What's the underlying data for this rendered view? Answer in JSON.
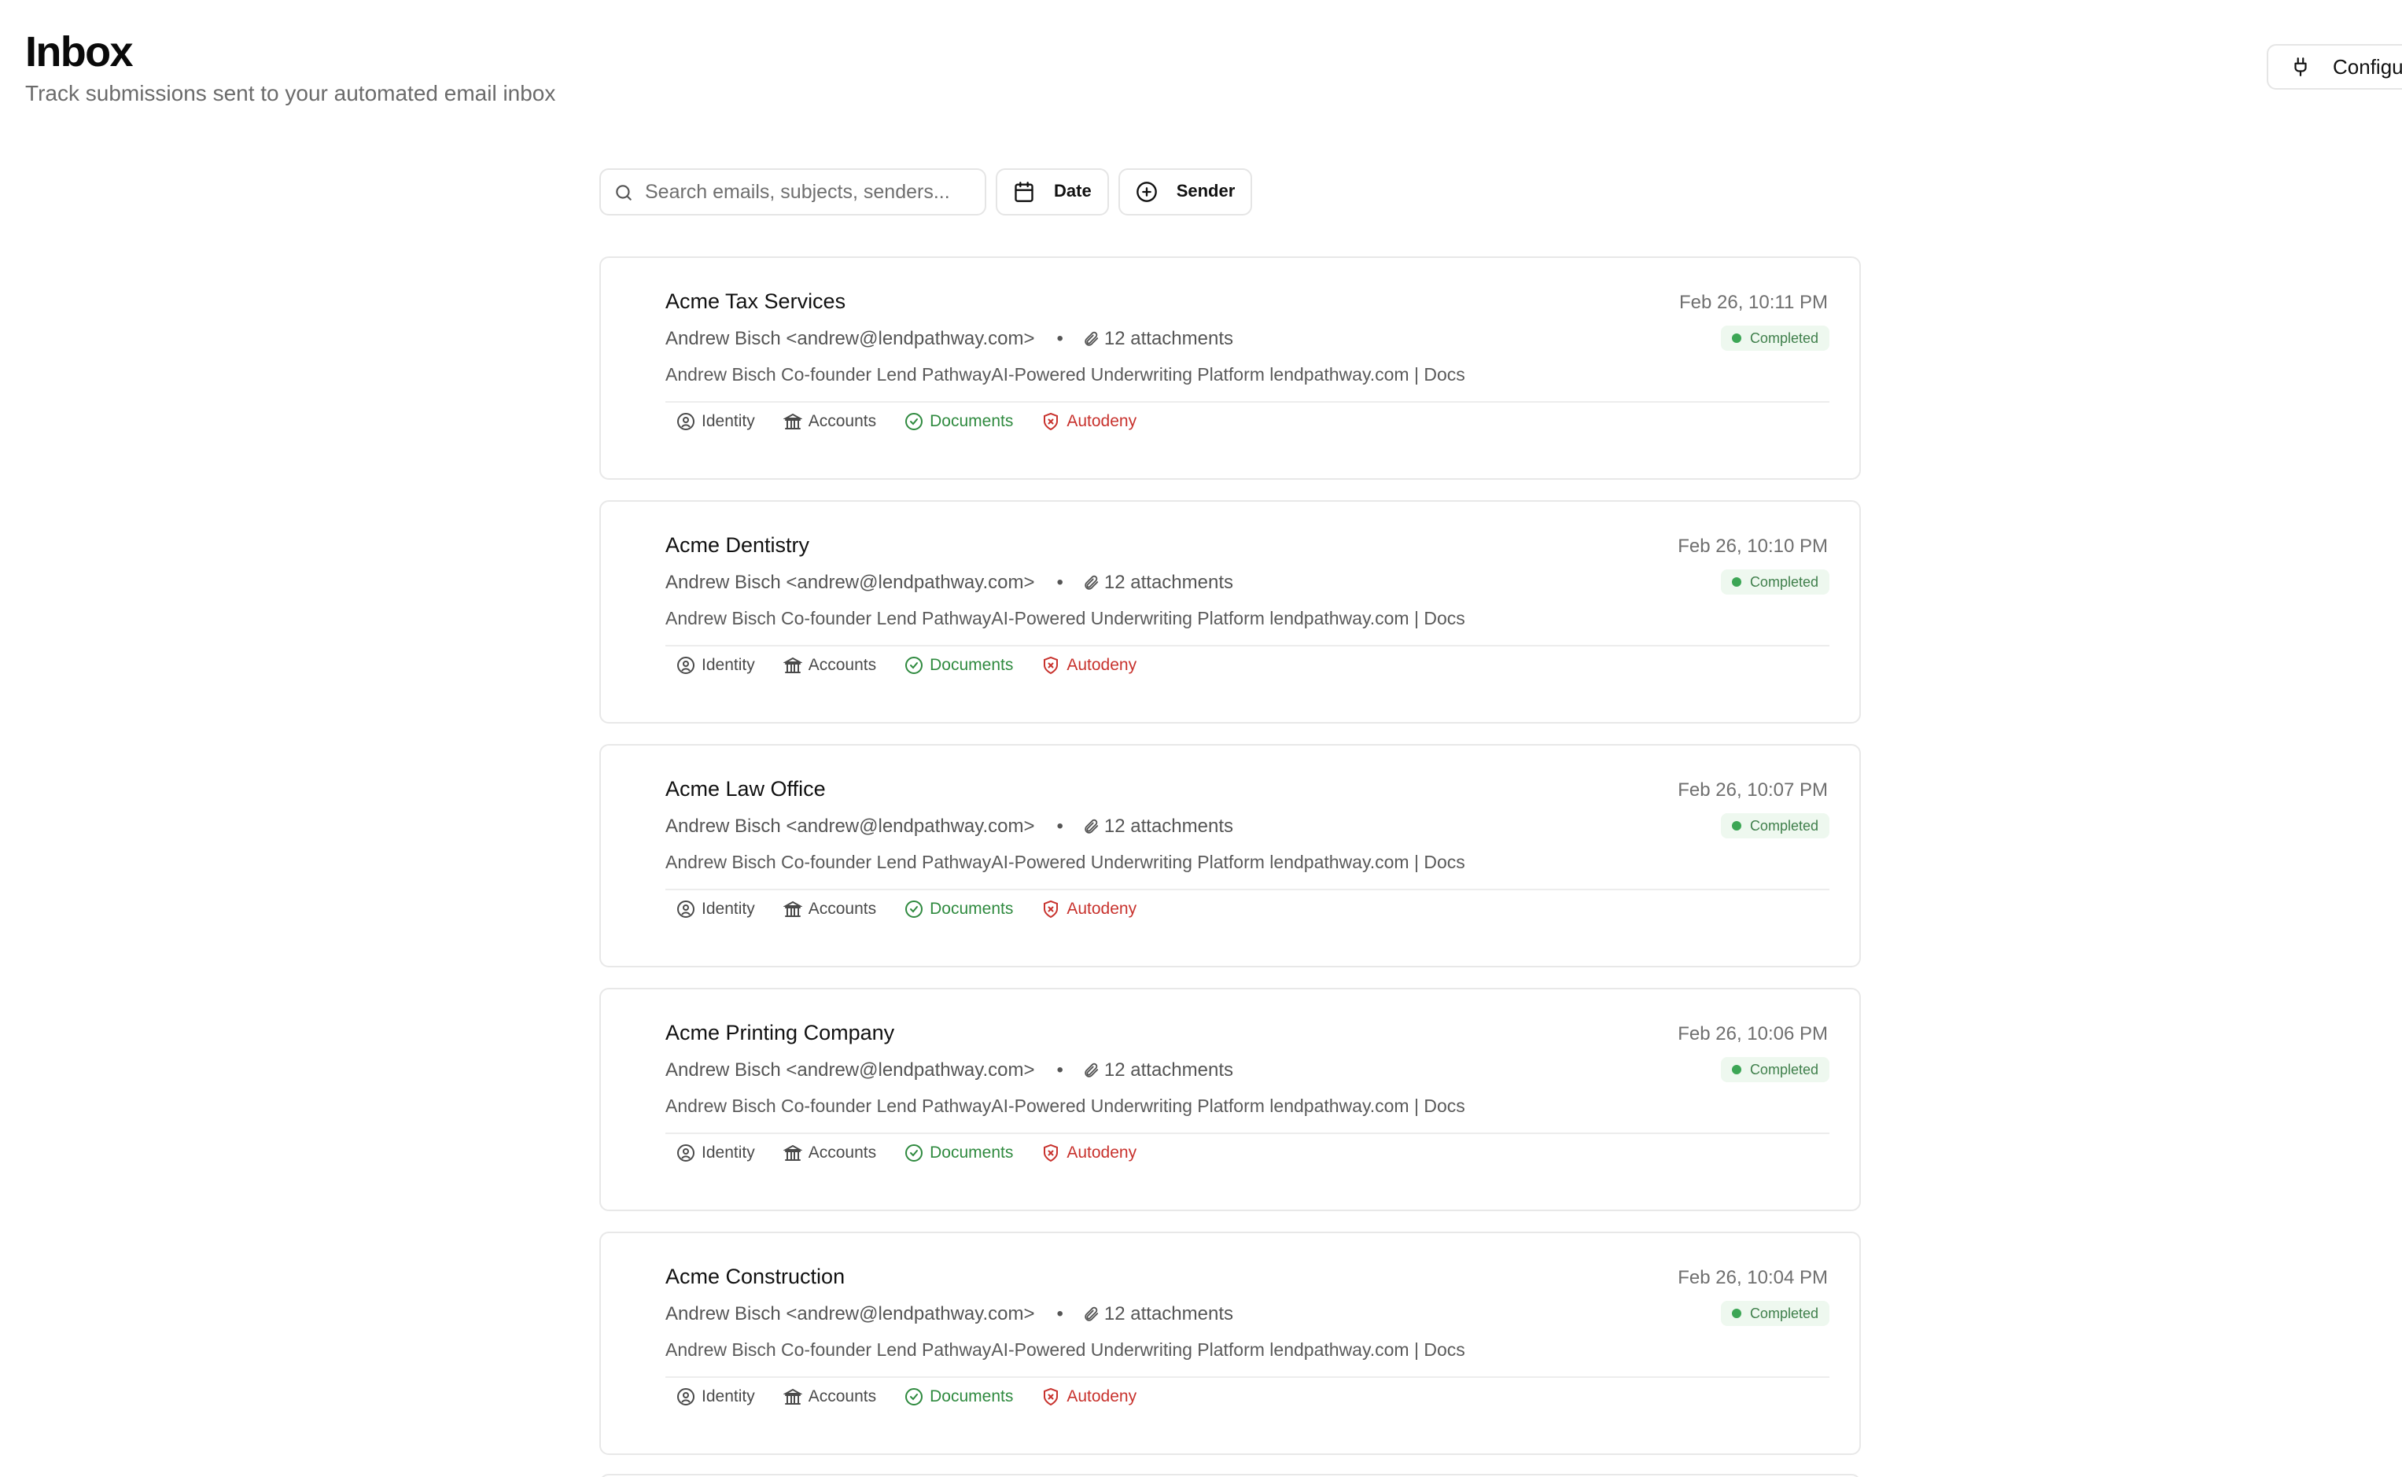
{
  "header": {
    "title": "Inbox",
    "subtitle": "Track submissions sent to your automated email inbox",
    "configure_label": "Configure",
    "configure_icon": "plug-icon"
  },
  "toolbar": {
    "search_placeholder": "Search emails, subjects, senders...",
    "search_value": "",
    "date_label": "Date",
    "sender_label": "Sender"
  },
  "colors": {
    "completed_badge_bg": "#eef8ef",
    "completed_text": "#3f7f4b",
    "documents_green": "#2f8a3f",
    "autodeny_red": "#c8322d"
  },
  "emails": [
    {
      "title": "Acme Tax Services",
      "date": "Feb 26, 10:11 PM",
      "sender": "Andrew Bisch <andrew@lendpathway.com>",
      "dot": "•",
      "attachments": "12 attachments",
      "status": "Completed",
      "preview": "Andrew Bisch Co-founder Lend PathwayAI-Powered Underwriting Platform lendpathway.com | Docs",
      "tags": {
        "identity": "Identity",
        "accounts": "Accounts",
        "documents": "Documents",
        "autodeny": "Autodeny"
      }
    },
    {
      "title": "Acme Dentistry",
      "date": "Feb 26, 10:10 PM",
      "sender": "Andrew Bisch <andrew@lendpathway.com>",
      "dot": "•",
      "attachments": "12 attachments",
      "status": "Completed",
      "preview": "Andrew Bisch Co-founder Lend PathwayAI-Powered Underwriting Platform lendpathway.com | Docs",
      "tags": {
        "identity": "Identity",
        "accounts": "Accounts",
        "documents": "Documents",
        "autodeny": "Autodeny"
      }
    },
    {
      "title": "Acme Law Office",
      "date": "Feb 26, 10:07 PM",
      "sender": "Andrew Bisch <andrew@lendpathway.com>",
      "dot": "•",
      "attachments": "12 attachments",
      "status": "Completed",
      "preview": "Andrew Bisch Co-founder Lend PathwayAI-Powered Underwriting Platform lendpathway.com | Docs",
      "tags": {
        "identity": "Identity",
        "accounts": "Accounts",
        "documents": "Documents",
        "autodeny": "Autodeny"
      }
    },
    {
      "title": "Acme Printing Company",
      "date": "Feb 26, 10:06 PM",
      "sender": "Andrew Bisch <andrew@lendpathway.com>",
      "dot": "•",
      "attachments": "12 attachments",
      "status": "Completed",
      "preview": "Andrew Bisch Co-founder Lend PathwayAI-Powered Underwriting Platform lendpathway.com | Docs",
      "tags": {
        "identity": "Identity",
        "accounts": "Accounts",
        "documents": "Documents",
        "autodeny": "Autodeny"
      }
    },
    {
      "title": "Acme Construction",
      "date": "Feb 26, 10:04 PM",
      "sender": "Andrew Bisch <andrew@lendpathway.com>",
      "dot": "•",
      "attachments": "12 attachments",
      "status": "Completed",
      "preview": "Andrew Bisch Co-founder Lend PathwayAI-Powered Underwriting Platform lendpathway.com | Docs",
      "tags": {
        "identity": "Identity",
        "accounts": "Accounts",
        "documents": "Documents",
        "autodeny": "Autodeny"
      }
    }
  ]
}
